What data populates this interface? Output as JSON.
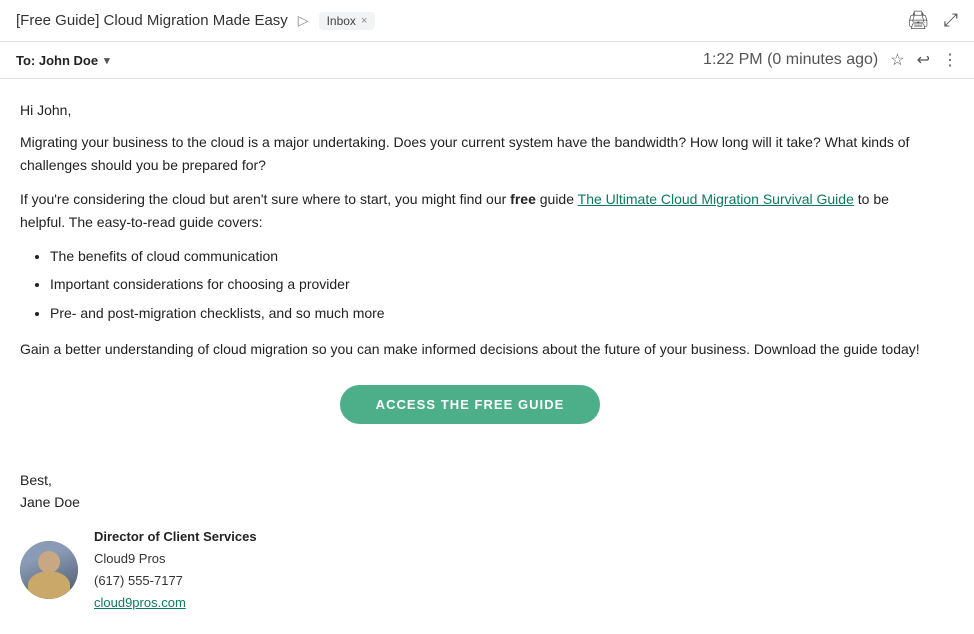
{
  "header": {
    "title": "[Free Guide] Cloud Migration Made Easy",
    "forward_icon": "▷",
    "inbox_label": "Inbox",
    "close_label": "×",
    "print_icon": "🖨",
    "popout_icon": "⤢"
  },
  "meta": {
    "to_label": "To: John Doe",
    "timestamp": "1:22 PM (0 minutes ago)",
    "star_icon": "☆",
    "reply_icon": "↩",
    "more_icon": "⋮"
  },
  "email": {
    "greeting": "Hi John,",
    "para1": "Migrating your business to the cloud is a major undertaking. Does your current system have the bandwidth? How long will it take? What kinds of challenges should you be prepared for?",
    "para2_prefix": "If you're considering the cloud but aren't sure where to start, you might find our ",
    "para2_bold": "free",
    "para2_link": "The Ultimate Cloud Migration Survival Guide",
    "para2_suffix": " to be helpful. The easy-to-read guide covers:",
    "bullets": [
      "The benefits of cloud communication",
      "Important considerations for choosing a provider",
      "Pre- and post-migration checklists, and so much more"
    ],
    "para3": "Gain a better understanding of cloud migration so you can make informed decisions about the future of your business. Download the guide today!",
    "cta_label": "ACCESS THE FREE GUIDE",
    "salutation": "Best,",
    "sender_name": "Jane Doe",
    "sig_title": "Director of Client Services",
    "sig_company": "Cloud9 Pros",
    "sig_phone": "(617) 555-7177",
    "sig_website": "cloud9pros.com"
  }
}
